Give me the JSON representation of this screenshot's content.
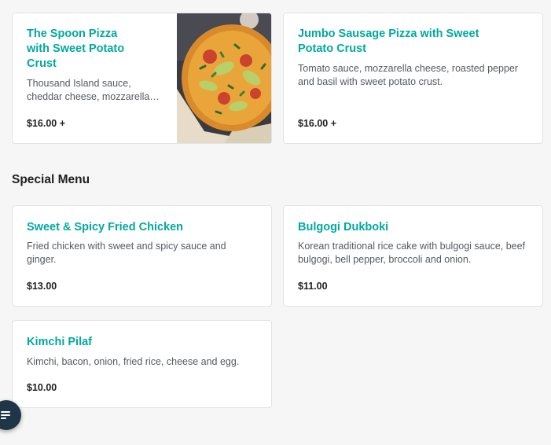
{
  "pizza_cards": [
    {
      "title": "The Spoon Pizza with Sweet Potato Crust",
      "description": "Thousand Island sauce, cheddar cheese, mozzarella…",
      "price": "$16.00 +"
    },
    {
      "title": "Jumbo Sausage Pizza with Sweet Potato Crust",
      "description": "Tomato sauce, mozzarella cheese, roasted pepper and basil with sweet potato crust.",
      "price": "$16.00 +"
    }
  ],
  "special_menu": {
    "heading": "Special Menu",
    "items": [
      {
        "title": "Sweet & Spicy Fried Chicken",
        "description": "Fried chicken with sweet and spicy sauce and ginger.",
        "price": "$13.00"
      },
      {
        "title": "Bulgogi Dukboki",
        "description": "Korean traditional rice cake with bulgogi sauce, beef bulgogi, bell pepper, broccoli and onion.",
        "price": "$11.00"
      },
      {
        "title": "Kimchi Pilaf",
        "description": "Kimchi, bacon, onion, fried rice, cheese and egg.",
        "price": "$10.00"
      }
    ]
  },
  "fab": {
    "icon": "menu-lines-icon"
  },
  "colors": {
    "accent": "#00a99d",
    "background": "#f6f6f7",
    "card": "#ffffff",
    "fab": "#1f3548"
  }
}
